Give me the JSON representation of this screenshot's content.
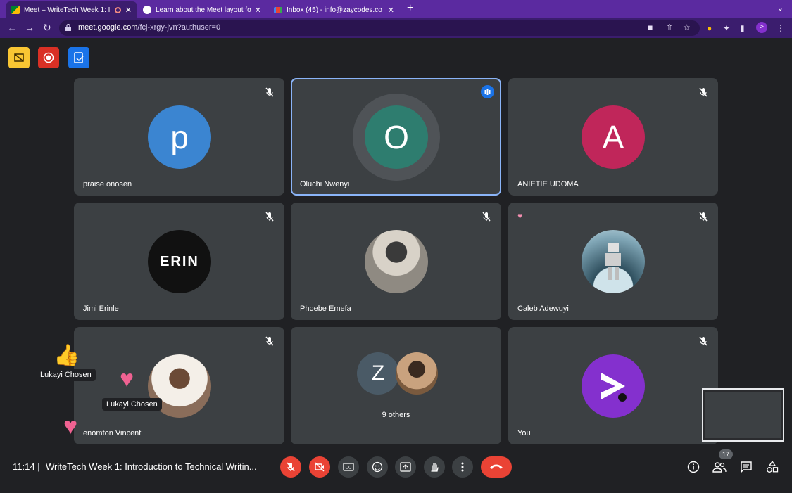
{
  "browser": {
    "tabs": [
      {
        "title": "Meet – WriteTech Week 1: I",
        "active": true
      },
      {
        "title": "Learn about the Meet layout fo",
        "active": false
      },
      {
        "title": "Inbox (45) - info@zaycodes.co",
        "active": false
      }
    ],
    "new_tab": "+",
    "url_host": "meet.google.com",
    "url_path": "/fcj-xrgy-jvn?authuser=0"
  },
  "colors": {
    "browser_frame": "#5b2aa0",
    "meet_bg": "#202124",
    "tile_bg": "#3c4043",
    "mic_off": "#ea4335",
    "speaking": "#8ab4f8"
  },
  "participants": [
    {
      "name": "praise onosen",
      "initial": "p",
      "avatar_color": "#3b85d1",
      "muted": true
    },
    {
      "name": "Oluchi Nwenyi",
      "initial": "O",
      "avatar_color": "#2e7d6f",
      "speaking": true
    },
    {
      "name": "ANIETIE UDOMA",
      "initial": "A",
      "avatar_color": "#c0265a",
      "muted": true
    },
    {
      "name": "Jimi Erinle",
      "avatar_text": "ERIN",
      "muted": true
    },
    {
      "name": "Phoebe Emefa",
      "muted": true
    },
    {
      "name": "Caleb Adewuyi",
      "muted": true,
      "reaction": "heart"
    },
    {
      "name": "enomfon Vincent",
      "muted": true
    },
    {
      "name": "9 others",
      "initial": "Z",
      "avatar_color": "#4a5a66"
    },
    {
      "name": "You",
      "muted": true
    }
  ],
  "reactions": [
    {
      "name": "Lukayi Chosen",
      "emoji": "thumbs-up"
    },
    {
      "name": "Lukayi Chosen",
      "emoji": "sparkling-heart"
    }
  ],
  "bottom": {
    "time": "11:14",
    "separator": "|",
    "meeting_title": "WriteTech Week 1: Introduction to Technical Writin...",
    "participant_count": "17"
  }
}
